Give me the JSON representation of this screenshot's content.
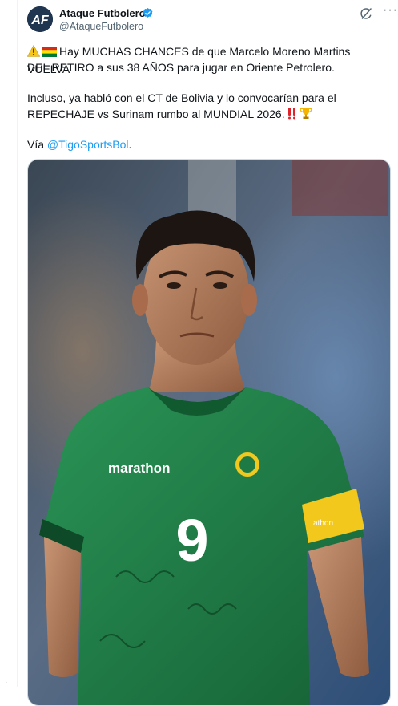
{
  "post": {
    "author_name": "Ataque Futbolero",
    "author_handle": "@AtaqueFutbolero",
    "line1": "Hay MUCHAS CHANCES de que Marcelo Moreno Martins VUELVA",
    "line2": "DEL RETIRO a sus 38 AÑOS para jugar en Oriente Petrolero.",
    "line3": "Incluso, ya habló con el CT de Bolivia y lo convocarían para el",
    "line4": "REPECHAJE vs Surinam rumbo al MUNDIAL 2026.",
    "via_prefix": "Vía ",
    "mention": "@TigoSportsBol",
    "via_suffix": "."
  },
  "icons": {
    "avatar": "ataque-futbolero-logo",
    "verified": "verified-badge-icon",
    "grok": "grok-icon",
    "more": "more-icon",
    "warning": "warning-emoji",
    "flag": "bolivia-flag-emoji",
    "exclaim": "double-exclamation-emoji",
    "trophy": "trophy-emoji"
  },
  "photo": {
    "jersey_brand": "marathon",
    "jersey_number": "9",
    "armband_text": "athon"
  },
  "colors": {
    "accent": "#1d9bf0",
    "jersey": "#1e7a45",
    "armband": "#f2c81c"
  }
}
